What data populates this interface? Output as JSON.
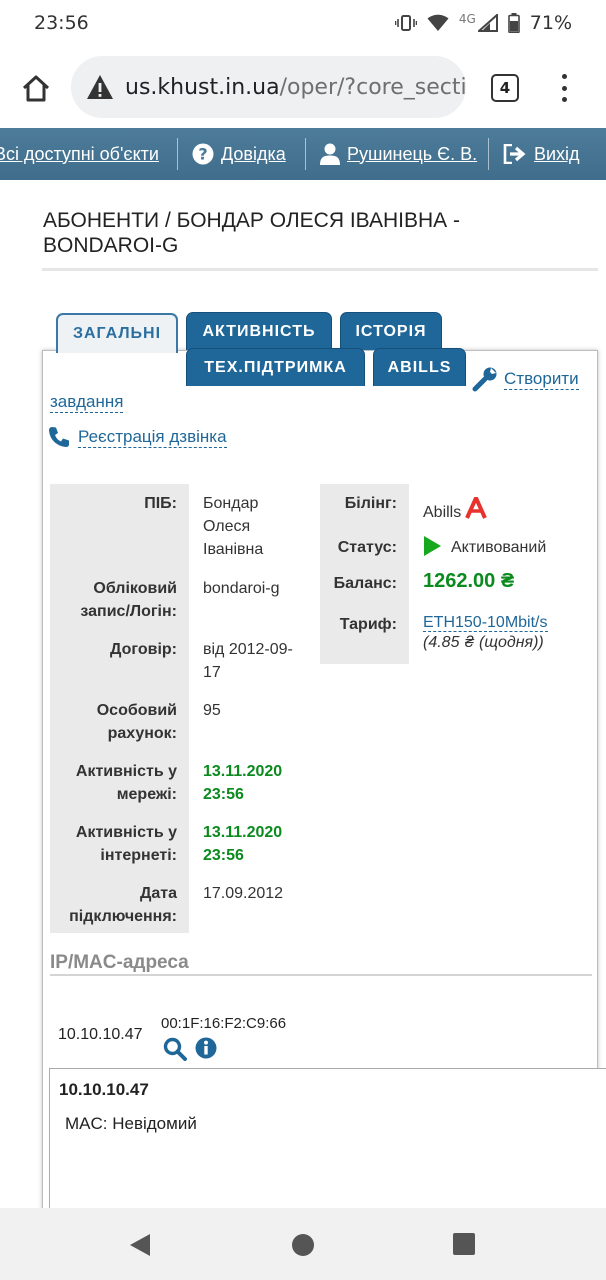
{
  "status_bar": {
    "time": "23:56",
    "network": "4G",
    "battery": "71%"
  },
  "browser": {
    "url_host": "us.khust.in.ua",
    "url_path": "/oper/?core_secti",
    "tab_count": "4"
  },
  "site_nav": {
    "objects": "Всі доступні об'єкти",
    "help": "Довідка",
    "user": "Рушинець Є. В.",
    "logout": "Вихід"
  },
  "page": {
    "title": "Абоненти / Бондар Олеся Іванівна - bondaroi-g"
  },
  "tabs": {
    "general": "ЗАГАЛЬНІ",
    "activity": "АКТИВНІСТЬ",
    "history": "ІСТОРІЯ",
    "support": "ТЕХ.ПІДТРИМКА",
    "abills": "ABILLS"
  },
  "actions": {
    "create_task_1": "Створити",
    "create_task_2": "завдання",
    "register_call": "Реєстрація дзвінка"
  },
  "subscriber": {
    "fio_label": "ПІБ:",
    "fio_value": "Бондар Олеся Іванівна",
    "login_label": "Обліковий запис/Логін:",
    "login_value": "bondaroi-g",
    "contract_label": "Договір:",
    "contract_value": "від 2012-09-17",
    "account_label": "Особовий рахунок:",
    "account_value": "95",
    "net_activity_label": "Активність у мережі:",
    "net_activity_value": "13.11.2020 23:56",
    "inet_activity_label": "Активність у інтернеті:",
    "inet_activity_value": "13.11.2020 23:56",
    "connect_date_label": "Дата підключення:",
    "connect_date_value": "17.09.2012"
  },
  "billing": {
    "billing_label": "Білінг:",
    "billing_value": "Abills",
    "status_label": "Статус:",
    "status_value": "Активований",
    "balance_label": "Баланс:",
    "balance_value": "1262.00 ₴",
    "tariff_label": "Тариф:",
    "tariff_value": "ETH150-10Mbit/s",
    "tariff_note": "(4.85 ₴ (щодня))"
  },
  "ip_section": {
    "heading": "IP/MAC-адреса",
    "ip": "10.10.10.47",
    "mac": "00:1F:16:F2:C9:66",
    "popup_title": "10.10.10.47",
    "popup_mac": "MAC: Невідомий"
  },
  "colors": {
    "nav_bg": "#4d7c9a",
    "tab_bg": "#1f6799",
    "link": "#1f6799",
    "green": "#0b8a1e",
    "abills_logo": "#e8322e"
  }
}
